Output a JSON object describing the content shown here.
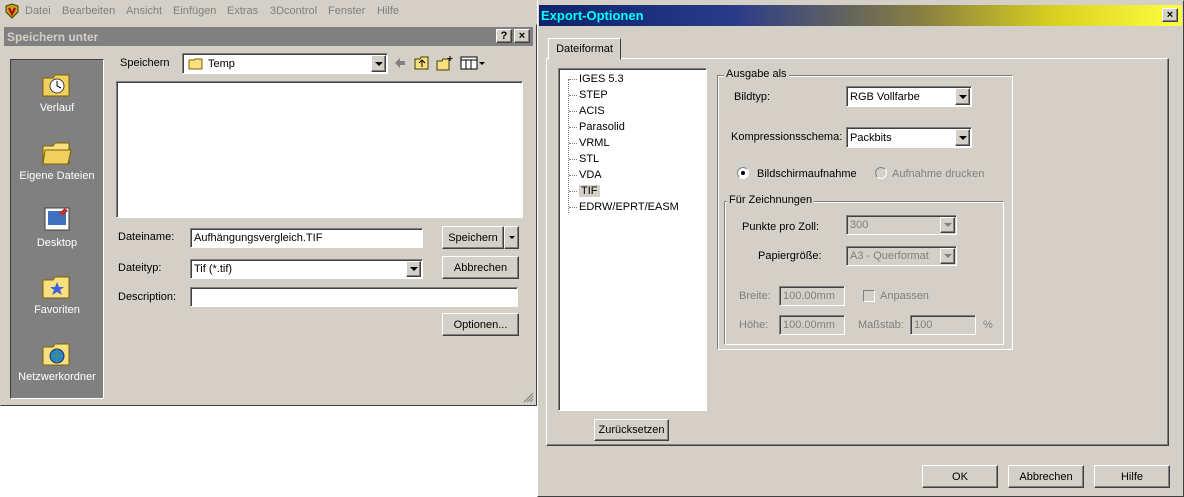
{
  "menubar": {
    "items": [
      "Datei",
      "Bearbeiten",
      "Ansicht",
      "Einfügen",
      "Extras",
      "3Dcontrol",
      "Fenster",
      "Hilfe"
    ]
  },
  "save_dialog": {
    "title": "Speichern unter",
    "help_btn": "?",
    "close_btn": "×",
    "places": [
      "Verlauf",
      "Eigene Dateien",
      "Desktop",
      "Favoriten",
      "Netzwerkordner"
    ],
    "location_label": "Speichern",
    "location_value": "Temp",
    "filename_label": "Dateiname:",
    "filename_value": "Aufhängungsvergleich.TIF",
    "filetype_label": "Dateityp:",
    "filetype_value": "Tif (*.tif)",
    "description_label": "Description:",
    "description_value": "",
    "save_button": "Speichern",
    "cancel_button": "Abbrechen",
    "options_button": "Optionen..."
  },
  "export_dialog": {
    "title": "Export-Optionen",
    "close_btn": "×",
    "tab": "Dateiformat",
    "formats": [
      "IGES 5.3",
      "STEP",
      "ACIS",
      "Parasolid",
      "VRML",
      "STL",
      "VDA",
      "TIF",
      "EDRW/EPRT/EASM"
    ],
    "selected_format": "TIF",
    "output_group": "Ausgabe als",
    "image_type_label": "Bildtyp:",
    "image_type_value": "RGB Vollfarbe",
    "compression_label": "Kompressionsschema:",
    "compression_value": "Packbits",
    "radio_screen": "Bildschirmaufnahme",
    "radio_print": "Aufnahme drucken",
    "drawings_group": "Für Zeichnungen",
    "dpi_label": "Punkte pro Zoll:",
    "dpi_value": "300",
    "paper_label": "Papiergröße:",
    "paper_value": "A3 - Querformat",
    "width_label": "Breite:",
    "width_value": "100.00mm",
    "fit_label": "Anpassen",
    "height_label": "Höhe:",
    "height_value": "100.00mm",
    "scale_label": "Maßstab:",
    "scale_value": "100",
    "scale_unit": "%",
    "reset_button": "Zurücksetzen",
    "ok_button": "OK",
    "cancel_button": "Abbrechen",
    "help_button": "Hilfe"
  }
}
